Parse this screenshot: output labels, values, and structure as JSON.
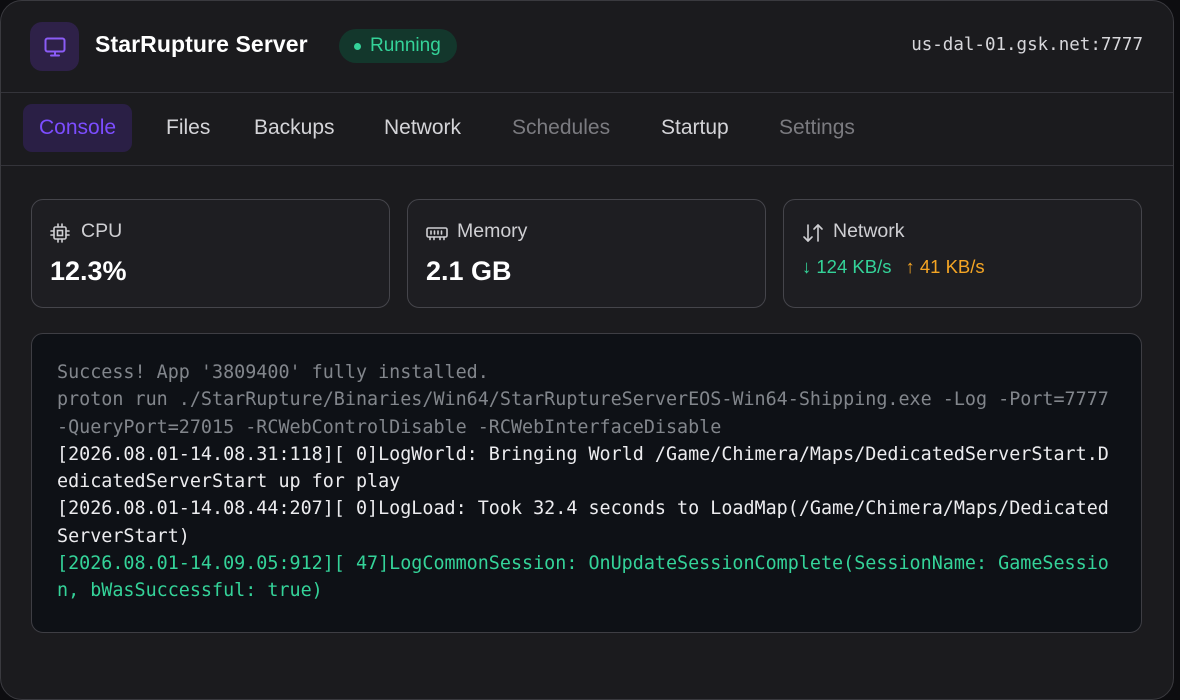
{
  "header": {
    "app_icon": "monitor-icon",
    "title": "StarRupture Server",
    "status": "Running",
    "address": "us-dal-01.gsk.net:7777"
  },
  "tabs": [
    {
      "label": "Console",
      "state": "active"
    },
    {
      "label": "Files",
      "state": "normal"
    },
    {
      "label": "Backups",
      "state": "normal"
    },
    {
      "label": "Network",
      "state": "normal"
    },
    {
      "label": "Schedules",
      "state": "disabled"
    },
    {
      "label": "Startup",
      "state": "normal"
    },
    {
      "label": "Settings",
      "state": "disabled"
    }
  ],
  "stats": {
    "cpu": {
      "label": "CPU",
      "value": "12.3%",
      "icon": "cpu-icon"
    },
    "memory": {
      "label": "Memory",
      "value": "2.1 GB",
      "icon": "memory-icon"
    },
    "network": {
      "label": "Network",
      "icon": "transfer-icon",
      "down": "↓ 124 KB/s",
      "up": "↑ 41 KB/s"
    }
  },
  "console": {
    "lines": [
      {
        "text": "Success! App '3809400' fully installed.",
        "tone": "dim"
      },
      {
        "text": "proton run ./StarRupture/Binaries/Win64/StarRuptureServerEOS-Win64-Shipping.exe -Log -Port=7777 -QueryPort=27015 -RCWebControlDisable -RCWebInterfaceDisable",
        "tone": "dim"
      },
      {
        "text": "[2026.08.01-14.08.31:118][ 0]LogWorld: Bringing World /Game/Chimera/Maps/DedicatedServerStart.DedicatedServerStart up for play",
        "tone": "normal"
      },
      {
        "text": "[2026.08.01-14.08.44:207][ 0]LogLoad: Took 32.4 seconds to LoadMap(/Game/Chimera/Maps/DedicatedServerStart)",
        "tone": "normal"
      },
      {
        "text": "[2026.08.01-14.09.05:912][ 47]LogCommonSession: OnUpdateSessionComplete(SessionName: GameSession, bWasSuccessful: true)",
        "tone": "green"
      }
    ]
  },
  "colors": {
    "accent": "#7c4dff",
    "success": "#34d399",
    "warning": "#f5a524",
    "background": "#1b1b1e"
  }
}
